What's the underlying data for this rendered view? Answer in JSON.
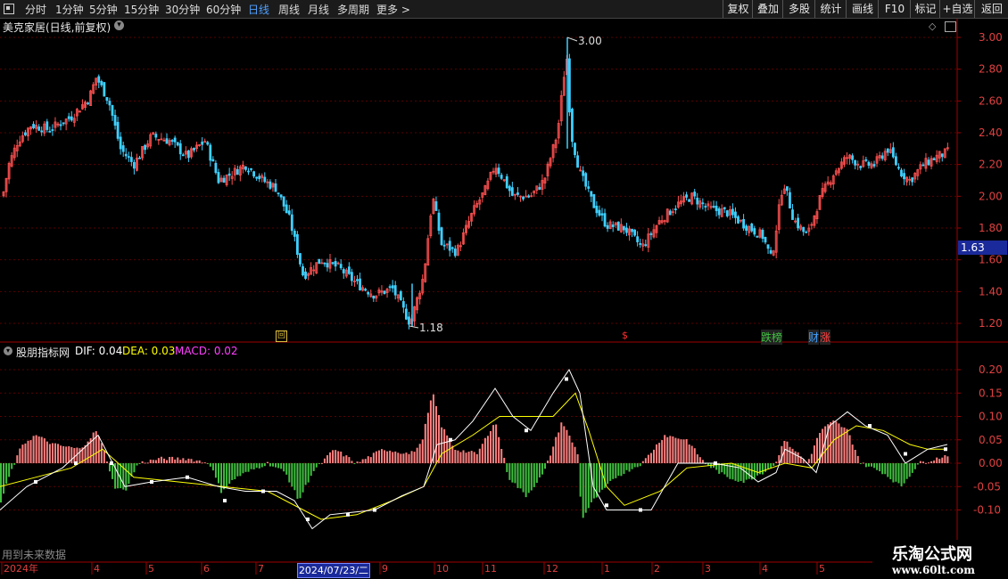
{
  "toolbar": {
    "periods": [
      "分时",
      "1分钟",
      "5分钟",
      "15分钟",
      "30分钟",
      "60分钟",
      "日线",
      "周线",
      "月线",
      "多周期",
      "更多 >"
    ],
    "active_period": "日线",
    "actions": [
      "复权",
      "叠加",
      "多股",
      "统计",
      "画线",
      "F10",
      "标记",
      "+自选",
      "返回"
    ]
  },
  "price_panel": {
    "title": "美克家居(日线,前复权)",
    "high_label": "3.00",
    "low_label": "1.18",
    "current_price": "1.63",
    "y_ticks": [
      "3.00",
      "2.80",
      "2.60",
      "2.40",
      "2.20",
      "2.00",
      "1.80",
      "1.60",
      "1.40",
      "1.20"
    ],
    "markers": [
      {
        "text": "回",
        "color": "#e0c040"
      },
      {
        "text": "$",
        "color": "#ff3030"
      },
      {
        "text": "跌榜",
        "color": "#40c040"
      },
      {
        "text": "财",
        "color": "#40a0ff"
      },
      {
        "text": "涨",
        "color": "#ff4040"
      }
    ]
  },
  "indicator_panel": {
    "name": "股朋指标网",
    "dif_label": "DIF: 0.04",
    "dea_label": "DEA: 0.03",
    "macd_label": "MACD: 0.02",
    "y_ticks": [
      "0.20",
      "0.15",
      "0.10",
      "0.05",
      "0.00",
      "-0.05",
      "-0.10"
    ],
    "footer_note": "用到未来数据"
  },
  "time_axis": {
    "labels": [
      "2024年",
      "4",
      "5",
      "6",
      "7",
      "2024/07/23/二",
      "9",
      "10",
      "11",
      "12",
      "1",
      "2",
      "3",
      "4",
      "5"
    ],
    "selected_date": "2024/07/23/二"
  },
  "watermark": {
    "title": "乐淘公式网",
    "url": "www.60lt.com"
  },
  "colors": {
    "up": "#ff5050",
    "down": "#3fd0ff",
    "macd_up": "#ff8080",
    "macd_down": "#40c040",
    "dif": "#ffffff",
    "dea": "#ffff00",
    "grid": "#5a0000",
    "axis": "#a00000"
  }
}
